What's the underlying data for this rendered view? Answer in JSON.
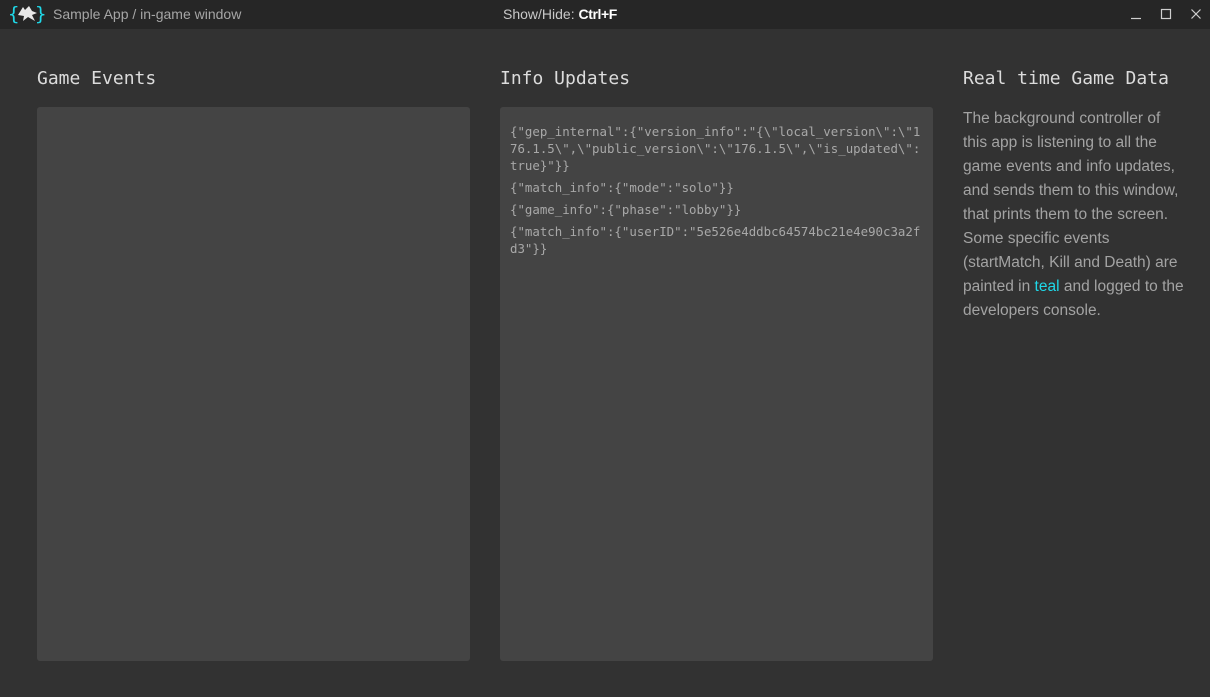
{
  "window": {
    "title": "Sample App / in-game window",
    "hotkey_label": "Show/Hide: ",
    "hotkey_key": "Ctrl+F",
    "logo_text": "{ }",
    "accent_color": "#1fd8e8"
  },
  "sections": {
    "game_events_title": "Game Events",
    "info_updates_title": "Info Updates",
    "realtime_title": "Real time Game Data"
  },
  "info_updates": [
    "{\"gep_internal\":{\"version_info\":\"{\\\"local_version\\\":\\\"176.1.5\\\",\\\"public_version\\\":\\\"176.1.5\\\",\\\"is_updated\\\":true}\"}}",
    "{\"match_info\":{\"mode\":\"solo\"}}",
    "{\"game_info\":{\"phase\":\"lobby\"}}",
    "{\"match_info\":{\"userID\":\"5e526e4ddbc64574bc21e4e90c3a2fd3\"}}"
  ],
  "game_events": [],
  "description": {
    "before_teal": "The background controller of this app is listening to all the game events and info updates, and sends them to this window, that prints them to the screen. Some specific events (startMatch, Kill and Death) are painted in ",
    "teal_word": "teal",
    "after_teal": " and logged to the developers console."
  },
  "icons": {
    "logo": "overwolf-logo-icon",
    "minimize": "minimize-icon",
    "maximize": "maximize-icon",
    "close": "close-icon"
  }
}
